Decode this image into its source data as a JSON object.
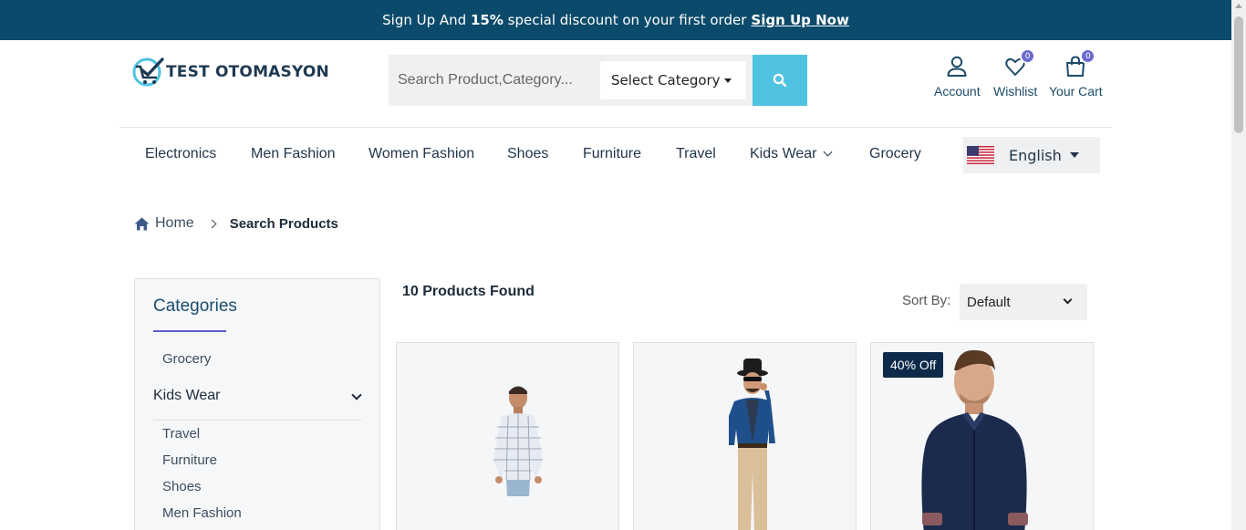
{
  "promo": {
    "prefix": "Sign Up And",
    "highlight": "15%",
    "middle": "special discount on your first order",
    "link": "Sign Up Now"
  },
  "brand": {
    "name": "TEST OTOMASYON"
  },
  "search": {
    "placeholder": "Search Product,Category...",
    "category_label": "Select Category"
  },
  "header_actions": {
    "account": "Account",
    "wishlist": "Wishlist",
    "wishlist_count": "0",
    "cart": "Your Cart",
    "cart_count": "0"
  },
  "nav": {
    "items": [
      "Electronics",
      "Men Fashion",
      "Women Fashion",
      "Shoes",
      "Furniture",
      "Travel",
      "Kids Wear",
      "Grocery"
    ]
  },
  "language": {
    "selected": "English"
  },
  "breadcrumb": {
    "home": "Home",
    "current": "Search Products"
  },
  "sidebar": {
    "title": "Categories",
    "top_item": "Grocery",
    "parent": "Kids Wear",
    "children": [
      "Travel",
      "Furniture",
      "Shoes",
      "Men Fashion"
    ]
  },
  "results": {
    "count_text": "10 Products Found",
    "sort_label": "Sort By:",
    "sort_value": "Default"
  },
  "products": [
    {
      "badge": ""
    },
    {
      "badge": ""
    },
    {
      "badge": "40% Off"
    }
  ],
  "colors": {
    "topbar": "#0b4a6a",
    "search_button": "#4fc3e0",
    "badge": "#6a6ad0",
    "discount": "#0e2a4a"
  }
}
